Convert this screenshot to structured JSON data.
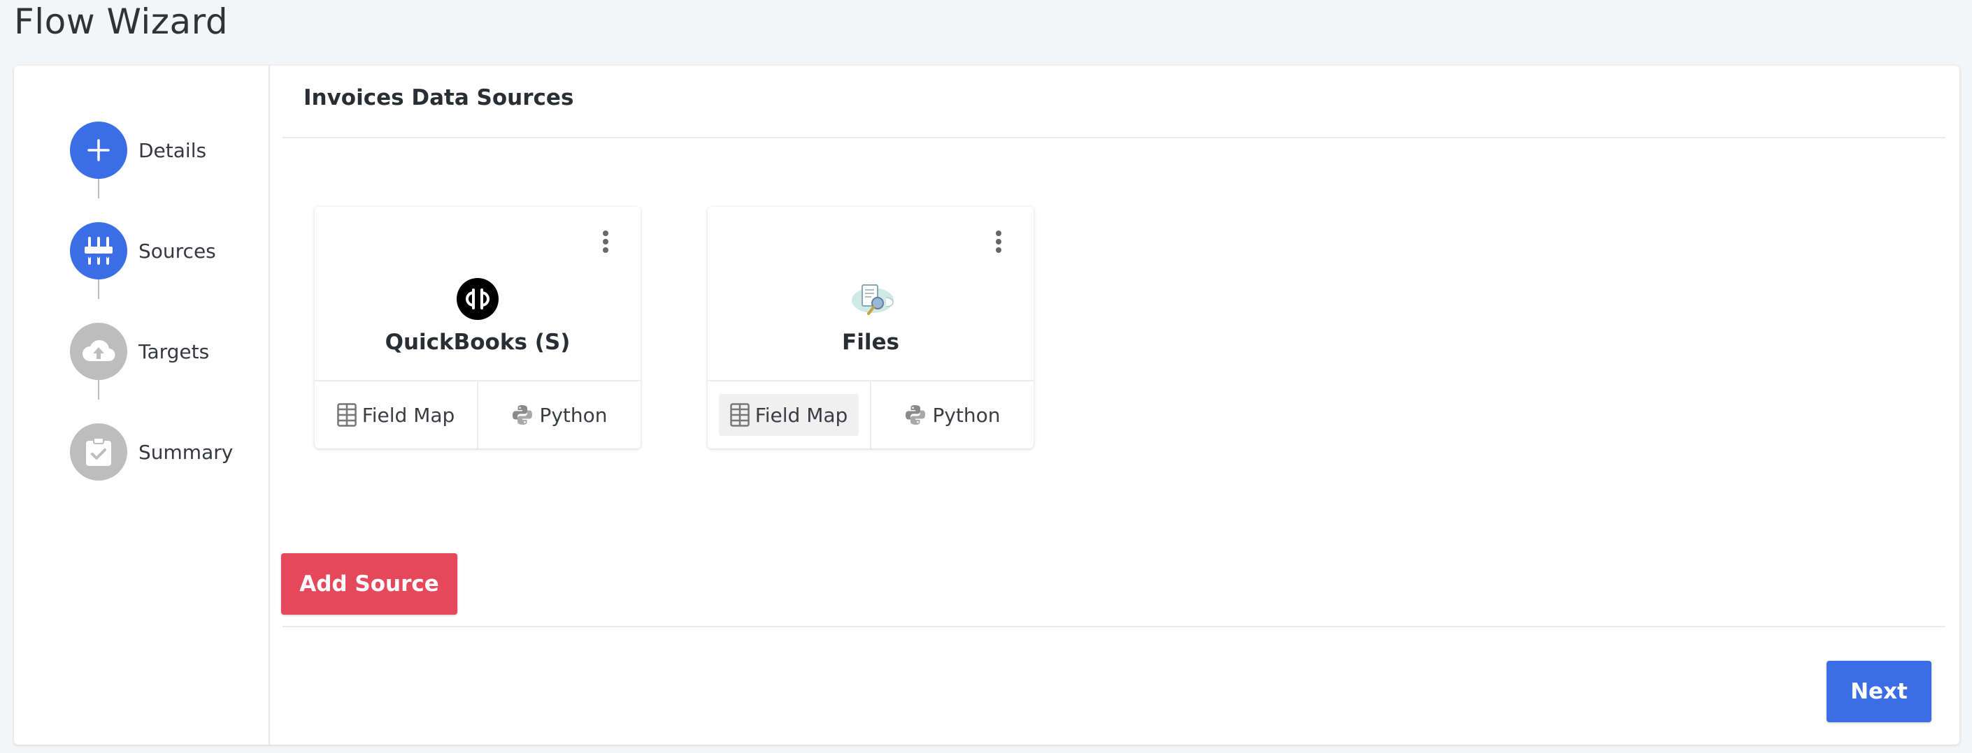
{
  "page": {
    "title": "Flow Wizard"
  },
  "stepper": {
    "steps": [
      {
        "label": "Details",
        "icon": "plus-icon",
        "state": "active"
      },
      {
        "label": "Sources",
        "icon": "sliders-icon",
        "state": "active"
      },
      {
        "label": "Targets",
        "icon": "cloud-upload-icon",
        "state": "inactive"
      },
      {
        "label": "Summary",
        "icon": "clipboard-check-icon",
        "state": "inactive"
      }
    ]
  },
  "main": {
    "section_title": "Invoices Data Sources",
    "sources": [
      {
        "name": "QuickBooks (S)",
        "logo": "quickbooks-logo-icon",
        "actions": [
          "Field Map",
          "Python"
        ]
      },
      {
        "name": "Files",
        "logo": "files-logo-icon",
        "actions": [
          "Field Map",
          "Python"
        ]
      }
    ],
    "add_source_label": "Add Source",
    "next_label": "Next"
  },
  "colors": {
    "primary": "#3b6ee6",
    "danger": "#e5485b",
    "inactive_step": "#bdbdbd",
    "background": "#f4f5f7"
  }
}
